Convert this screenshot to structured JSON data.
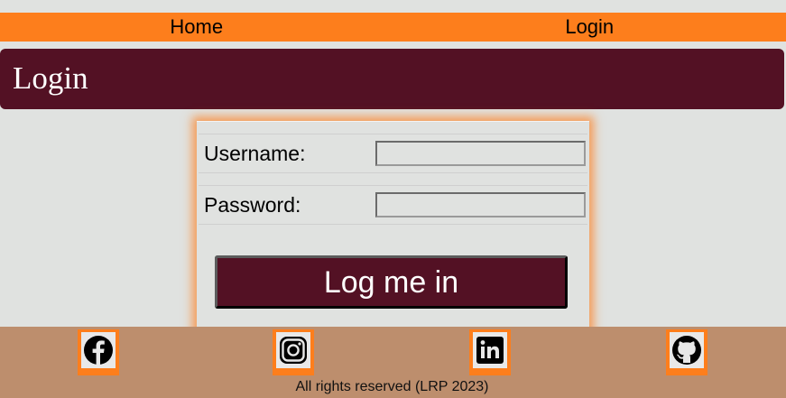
{
  "nav": {
    "home_label": "Home",
    "login_label": "Login"
  },
  "banner": {
    "title": "Login"
  },
  "form": {
    "username_label": "Username:",
    "username_value": "",
    "password_label": "Password:",
    "password_value": "",
    "submit_label": "Log me in"
  },
  "footer": {
    "social": [
      {
        "icon": "facebook-icon"
      },
      {
        "icon": "instagram-icon"
      },
      {
        "icon": "linkedin-icon"
      },
      {
        "icon": "github-icon"
      }
    ],
    "copyright": "All rights reserved (LRP 2023)"
  },
  "colors": {
    "accent": "#fd7e1c",
    "brand": "#531124",
    "footer": "#bd8e6d",
    "page_background": "#e0e2e0"
  }
}
